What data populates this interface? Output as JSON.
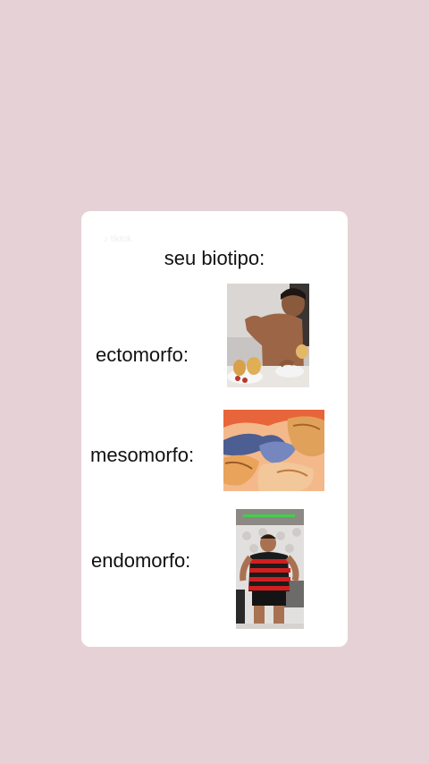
{
  "watermark": "♪ tiktok",
  "card": {
    "title": "seu biotipo:"
  },
  "rows": [
    {
      "label": "ectomorfo:",
      "image": "boy-eating-photo"
    },
    {
      "label": "mesomorfo:",
      "image": "anime-explosion-frame"
    },
    {
      "label": "endomorfo:",
      "image": "man-in-striped-jersey-photo"
    }
  ]
}
